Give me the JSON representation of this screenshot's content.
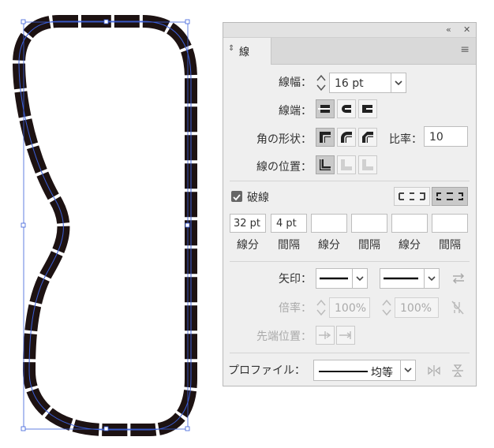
{
  "panel": {
    "tab_label": "線",
    "weight": {
      "label": "線幅：",
      "value": "16 pt"
    },
    "cap": {
      "label": "線端："
    },
    "corner": {
      "label": "角の形状：",
      "limit_label": "比率：",
      "limit_value": "10"
    },
    "align": {
      "label": "線の位置："
    },
    "dashed": {
      "label": "破線",
      "checked": true,
      "fields": [
        {
          "value": "32 pt",
          "label": "線分"
        },
        {
          "value": "4 pt",
          "label": "間隔"
        },
        {
          "value": "",
          "label": "線分"
        },
        {
          "value": "",
          "label": "間隔"
        },
        {
          "value": "",
          "label": "線分"
        },
        {
          "value": "",
          "label": "間隔"
        }
      ]
    },
    "arrow": {
      "label": "矢印："
    },
    "scale": {
      "label": "倍率：",
      "start": "100%",
      "end": "100%"
    },
    "align_arrow": {
      "label": "先端位置："
    },
    "profile": {
      "label": "プロファイル：",
      "value": "均等"
    }
  },
  "colors": {
    "stroke": "#1d1212",
    "path": "#3b5fd9",
    "panel": "#efefef"
  }
}
